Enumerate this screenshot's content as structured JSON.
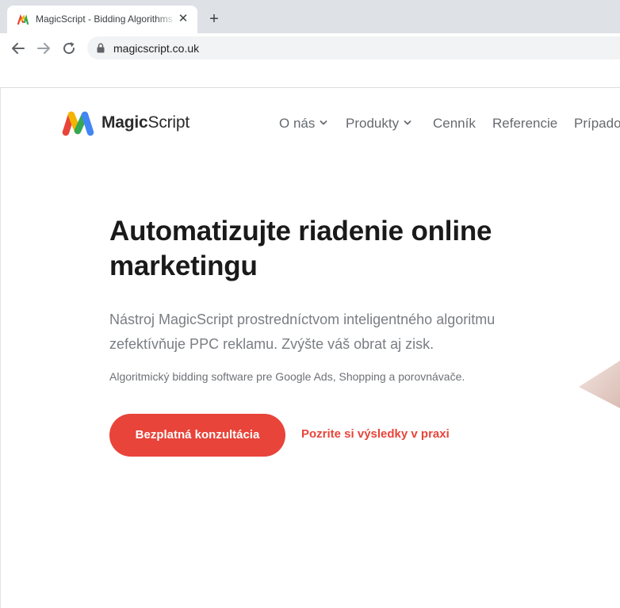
{
  "browser": {
    "tab_title": "MagicScript - Bidding Algorithms",
    "url": "magicscript.co.uk",
    "icons": [
      "favicon-icon",
      "close-icon",
      "plus-icon",
      "back-arrow-icon",
      "forward-arrow-icon",
      "reload-icon",
      "lock-icon"
    ]
  },
  "header": {
    "logo_text_bold": "Magic",
    "logo_text_regular": "Script",
    "nav": [
      {
        "label": "O nás",
        "has_dropdown": true
      },
      {
        "label": "Produkty",
        "has_dropdown": true
      },
      {
        "label": "Cenník",
        "has_dropdown": false
      },
      {
        "label": "Referencie",
        "has_dropdown": false
      },
      {
        "label": "Prípado",
        "has_dropdown": false
      }
    ]
  },
  "hero": {
    "title": "Automatizujte riadenie online marketingu",
    "lead": "Nástroj MagicScript prostredníctvom inteligentného algoritmu zefektívňuje PPC reklamu. Zvýšte váš obrat aj zisk.",
    "sub": "Algoritmický bidding software pre Google Ads, Shopping a porovnávače.",
    "cta_label": "Bezplatná konzultácia",
    "secondary_link": "Pozrite si výsledky v praxi"
  },
  "colors": {
    "accent": "#e8443a",
    "title_text": "#1a1a1a",
    "nav_text": "#666a6f",
    "chrome_bg": "#dee1e6",
    "omnibox_bg": "#f1f3f4"
  }
}
